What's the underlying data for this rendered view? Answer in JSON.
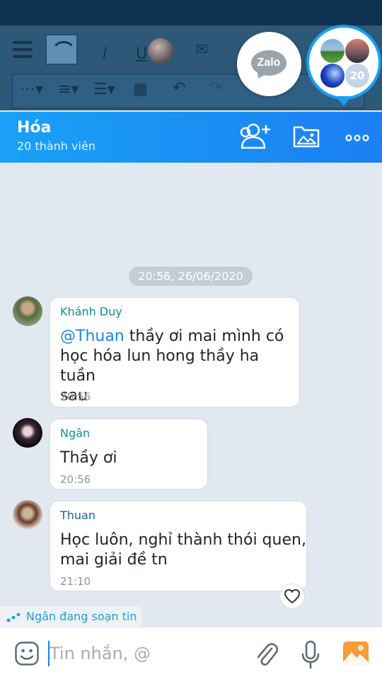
{
  "header": {
    "group_name": "Hóa",
    "member_count_label": "20 thành viên",
    "accent": "#1b86f2"
  },
  "floating": {
    "zalo_label": "Zalo",
    "group_member_badge": "20"
  },
  "chat": {
    "date_separator": "20:56, 26/06/2020",
    "messages": [
      {
        "sender": "Khánh Duy",
        "sender_color": "#0e8f8f",
        "mention": "@Thuan",
        "line1": " thầy ơi mai mình có",
        "line2": "học hóa lun hong thầy ha tuần",
        "line3": "sau",
        "time": "20:56"
      },
      {
        "sender": "Ngân",
        "sender_color": "#0e8f8f",
        "text": "Thầy ơi",
        "time": "20:56"
      },
      {
        "sender": "Thuan",
        "sender_color": "#1b5fae",
        "line1": "Học luôn, nghỉ thành thói quen,",
        "line2": "mai giải đề tn",
        "time": "21:10"
      }
    ],
    "typing_indicator": "Ngân đang soạn tin"
  },
  "input": {
    "placeholder": "Tin nhắn, @"
  },
  "icons": {
    "emoji": "emoji-icon",
    "attach": "paperclip-icon",
    "mic": "microphone-icon",
    "gallery": "image-gallery-icon",
    "add_member": "add-member-icon",
    "media": "media-folder-icon",
    "more": "more-options-icon",
    "heart": "heart-icon"
  }
}
